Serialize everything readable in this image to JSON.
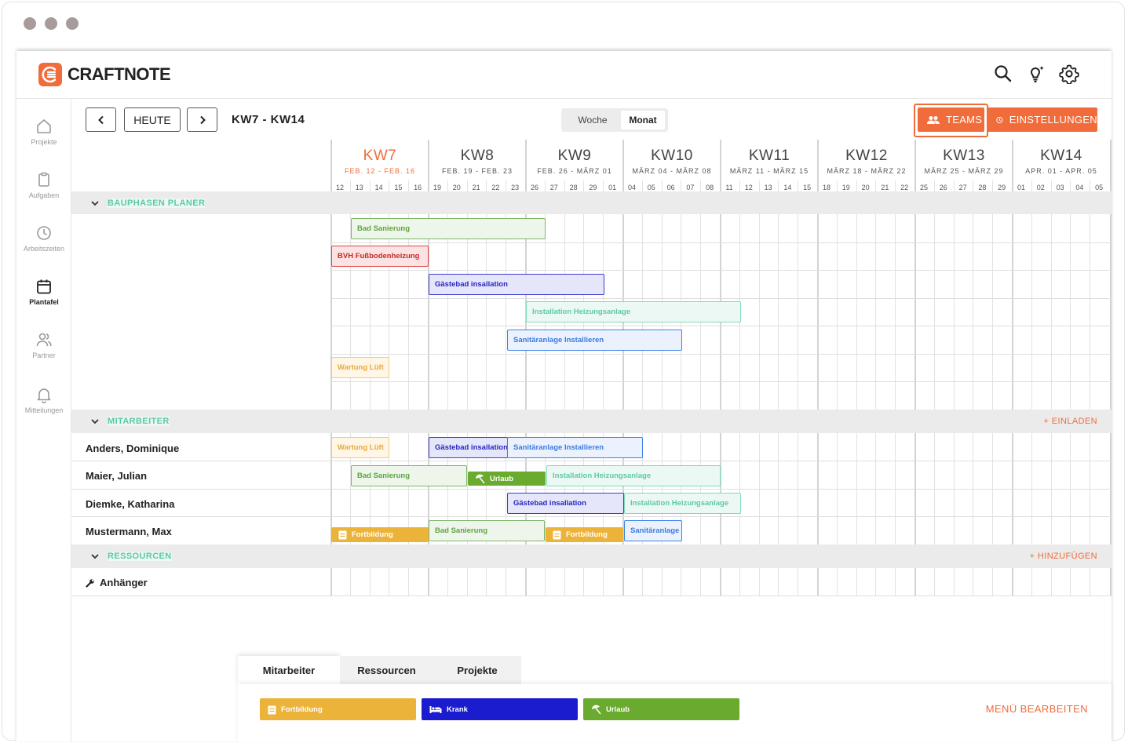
{
  "app": {
    "name": "CRAFTNOTE"
  },
  "nav": [
    {
      "label": "Projekte",
      "icon": "home-icon"
    },
    {
      "label": "Aufgaben",
      "icon": "clipboard-icon"
    },
    {
      "label": "Arbeitszeiten",
      "icon": "clock-icon"
    },
    {
      "label": "Plantafel",
      "icon": "calendar-icon",
      "active": true
    },
    {
      "label": "Partner",
      "icon": "users-icon"
    },
    {
      "label": "Mitteilungen",
      "icon": "bell-icon"
    }
  ],
  "toolbar": {
    "today": "HEUTE",
    "range": "KW7 - KW14",
    "view_week": "Woche",
    "view_month": "Monat",
    "teams": "TEAMS",
    "settings": "EINSTELLUNGEN"
  },
  "weeks": [
    {
      "kw": "KW7",
      "range": "FEB. 12 - FEB. 16",
      "days": [
        "12",
        "13",
        "14",
        "15",
        "16"
      ],
      "current": true
    },
    {
      "kw": "KW8",
      "range": "FEB. 19 - FEB. 23",
      "days": [
        "19",
        "20",
        "21",
        "22",
        "23"
      ]
    },
    {
      "kw": "KW9",
      "range": "FEB. 26 - MÄRZ 01",
      "days": [
        "26",
        "27",
        "28",
        "29",
        "01"
      ]
    },
    {
      "kw": "KW10",
      "range": "MÄRZ 04 - MÄRZ 08",
      "days": [
        "04",
        "05",
        "06",
        "07",
        "08"
      ]
    },
    {
      "kw": "KW11",
      "range": "MÄRZ 11 - MÄRZ 15",
      "days": [
        "11",
        "12",
        "13",
        "14",
        "15"
      ]
    },
    {
      "kw": "KW12",
      "range": "MÄRZ 18 - MÄRZ 22",
      "days": [
        "18",
        "19",
        "20",
        "21",
        "22"
      ]
    },
    {
      "kw": "KW13",
      "range": "MÄRZ 25 - MÄRZ 29",
      "days": [
        "25",
        "26",
        "27",
        "28",
        "29"
      ]
    },
    {
      "kw": "KW14",
      "range": "APR. 01 - APR. 05",
      "days": [
        "01",
        "02",
        "03",
        "04",
        "05"
      ]
    }
  ],
  "sections": {
    "phases": {
      "title": "BAUPHASEN PLANER"
    },
    "staff": {
      "title": "MITARBEITER",
      "action": "+ EINLADEN"
    },
    "resources": {
      "title": "RESSOURCEN",
      "action": "+ HINZUFÜGEN"
    }
  },
  "phases": [
    {
      "label": "Bad Sanierung",
      "color": "green"
    },
    {
      "label": "BVH Fußbodenheizung",
      "color": "red"
    },
    {
      "label": "Gästebad insallation",
      "color": "blue"
    },
    {
      "label": "Installation Heizungsanlage",
      "color": "teal"
    },
    {
      "label": "Sanitäranlage Installieren",
      "color": "lightblue"
    },
    {
      "label": "Wartung Lüft",
      "color": "yellow"
    }
  ],
  "staff": [
    {
      "name": "Anders, Dominique",
      "bars": [
        {
          "label": "Wartung Lüft",
          "color": "yellow"
        },
        {
          "label": "Gästebad insallation",
          "color": "blue"
        },
        {
          "label": "Sanitäranlage Installieren",
          "color": "lightblue"
        }
      ]
    },
    {
      "name": "Maier, Julian",
      "bars": [
        {
          "label": "Bad Sanierung",
          "color": "green"
        },
        {
          "label": "Urlaub",
          "type": "absence-urlaub"
        },
        {
          "label": "Installation Heizungsanlage",
          "color": "teal"
        }
      ]
    },
    {
      "name": "Diemke, Katharina",
      "bars": [
        {
          "label": "Gästebad insallation",
          "color": "blue"
        },
        {
          "label": "Installation Heizungsanlage",
          "color": "teal"
        }
      ]
    },
    {
      "name": "Mustermann, Max",
      "bars": [
        {
          "label": "Fortbildung",
          "type": "absence-fortbildung"
        },
        {
          "label": "Bad Sanierung",
          "color": "green"
        },
        {
          "label": "Fortbildung",
          "type": "absence-fortbildung"
        },
        {
          "label": "Sanitäranlage",
          "color": "lightblue"
        }
      ]
    }
  ],
  "resources": [
    {
      "name": "Anhänger",
      "icon": "wrench-icon"
    }
  ],
  "legend": {
    "tabs": [
      "Mitarbeiter",
      "Ressourcen",
      "Projekte"
    ],
    "chips": [
      {
        "label": "Fortbildung",
        "color": "#ecb33a",
        "icon": "clipboard-icon"
      },
      {
        "label": "Krank",
        "color": "#1c1ccf",
        "icon": "bed-icon"
      },
      {
        "label": "Urlaub",
        "color": "#6aaa2f",
        "icon": "umbrella-icon"
      }
    ],
    "edit": "MENÜ BEARBEITEN"
  },
  "colors": {
    "accent": "#f06c3a"
  }
}
